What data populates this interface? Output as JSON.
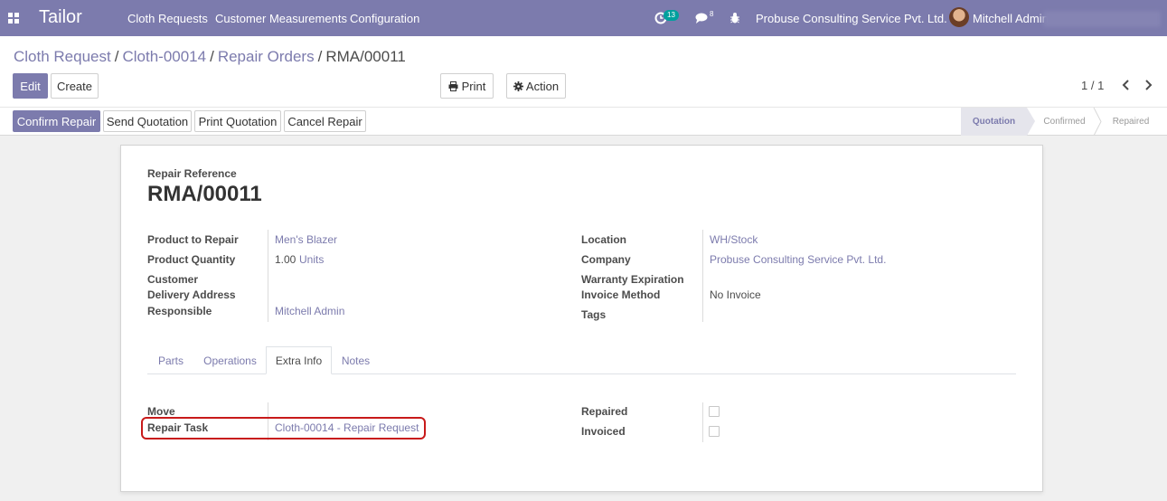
{
  "navbar": {
    "brand": "Tailor",
    "menu": [
      "Cloth Requests",
      "Customer Measurements",
      "Configuration"
    ],
    "activity_count": "13",
    "messages_count": "8",
    "company": "Probuse Consulting Service Pvt. Ltd.",
    "user": "Mitchell Admin"
  },
  "breadcrumb": {
    "items": [
      "Cloth Request",
      "Cloth-00014",
      "Repair Orders"
    ],
    "current": "RMA/00011"
  },
  "buttons": {
    "edit": "Edit",
    "create": "Create",
    "print": "Print",
    "action": "Action"
  },
  "pager": {
    "value": "1 / 1"
  },
  "statusbar": {
    "buttons": [
      "Confirm Repair",
      "Send Quotation",
      "Print Quotation",
      "Cancel Repair"
    ],
    "stages": [
      "Quotation",
      "Confirmed",
      "Repaired"
    ],
    "active_stage": "Quotation"
  },
  "form": {
    "ref_label": "Repair Reference",
    "ref_value": "RMA/00011",
    "left": {
      "product_label": "Product to Repair",
      "product_value": "Men's Blazer",
      "qty_label": "Product Quantity",
      "qty_value": "1.00",
      "qty_uom": "Units",
      "customer_label": "Customer",
      "delivery_label": "Delivery Address",
      "responsible_label": "Responsible",
      "responsible_value": "Mitchell Admin"
    },
    "right": {
      "location_label": "Location",
      "location_value": "WH/Stock",
      "company_label": "Company",
      "company_value": "Probuse Consulting Service Pvt. Ltd.",
      "warranty_label": "Warranty Expiration",
      "invoice_method_label": "Invoice Method",
      "invoice_method_value": "No Invoice",
      "tags_label": "Tags"
    },
    "tabs": [
      "Parts",
      "Operations",
      "Extra Info",
      "Notes"
    ],
    "active_tab": "Extra Info",
    "extra": {
      "move_label": "Move",
      "repair_task_label": "Repair Task",
      "repair_task_value": "Cloth-00014 - Repair Request",
      "repaired_label": "Repaired",
      "invoiced_label": "Invoiced"
    }
  },
  "colors": {
    "brand": "#7c7bad",
    "highlight": "#c81a1a"
  }
}
